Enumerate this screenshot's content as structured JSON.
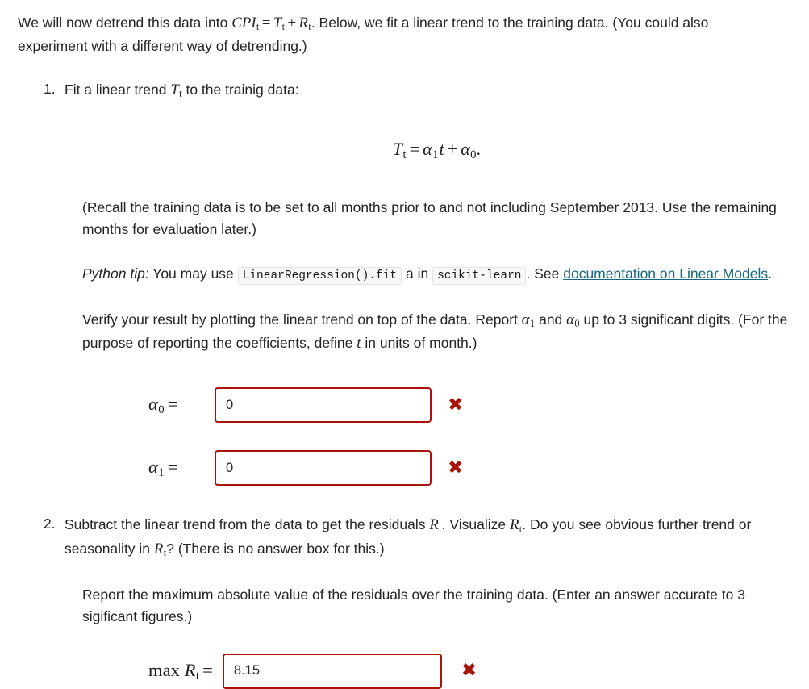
{
  "intro": {
    "text_before_math": "We will now detrend this data into ",
    "math_cpi": "CPI_t = T_t + R_t",
    "text_after_math": ". Below, we fit a linear trend to the training data. (You could also experiment with a different way of detrending.)"
  },
  "step1": {
    "number": "1.",
    "title_before": "Fit a linear trend ",
    "title_math": "T_t",
    "title_after": " to the trainig data:",
    "display_equation": "T_t = α_1 t + α_0 .",
    "recall_note": "(Recall the training data is to be set to all months prior to and not including September 2013. Use the remaining months for evaluation later.)",
    "tip_label": "Python tip:",
    "tip_text_1": "You may use",
    "tip_code_1": "LinearRegression().fit",
    "tip_text_2": "a in",
    "tip_code_2": "scikit-learn",
    "tip_text_3": ". See",
    "tip_link": "documentation on Linear Models",
    "tip_text_4": ".",
    "verify_1": "Verify your result by plotting the linear trend on top of the data. Report ",
    "verify_math_a1": "α_1",
    "verify_2": " and ",
    "verify_math_a0": "α_0",
    "verify_3": " up to 3 significant digits. (For the purpose of reporting the coefficients, define ",
    "verify_math_t": "t",
    "verify_4": " in units of month.)"
  },
  "answers": {
    "alpha0": {
      "label": "α_0 =",
      "value": "0",
      "status_icon": "wrong-mark-icon",
      "status": "incorrect"
    },
    "alpha1": {
      "label": "α_1 =",
      "value": "0",
      "status_icon": "wrong-mark-icon",
      "status": "incorrect"
    },
    "max_residual": {
      "label": "max R_t =",
      "value": "8.15",
      "status_icon": "wrong-mark-icon",
      "status": "incorrect"
    },
    "wrong_glyph": "✖"
  },
  "step2": {
    "number": "2.",
    "text_1": "Subtract the linear trend from the data to get the residuals ",
    "math_r1": "R_t",
    "text_2": ". Visualize ",
    "math_r2": "R_t",
    "text_3": ". Do you see obvious further trend or seasonality in ",
    "math_r3": "R_t",
    "text_4": "? (There is no answer box for this.)",
    "report_text": "Report the maximum absolute value of the residuals over the training data. (Enter an answer accurate to 3 sigificant figures.)"
  },
  "colors": {
    "error_red": "#a81408",
    "link_teal": "#15687f",
    "body_text": "#242424",
    "code_background": "#f7f7f7"
  }
}
